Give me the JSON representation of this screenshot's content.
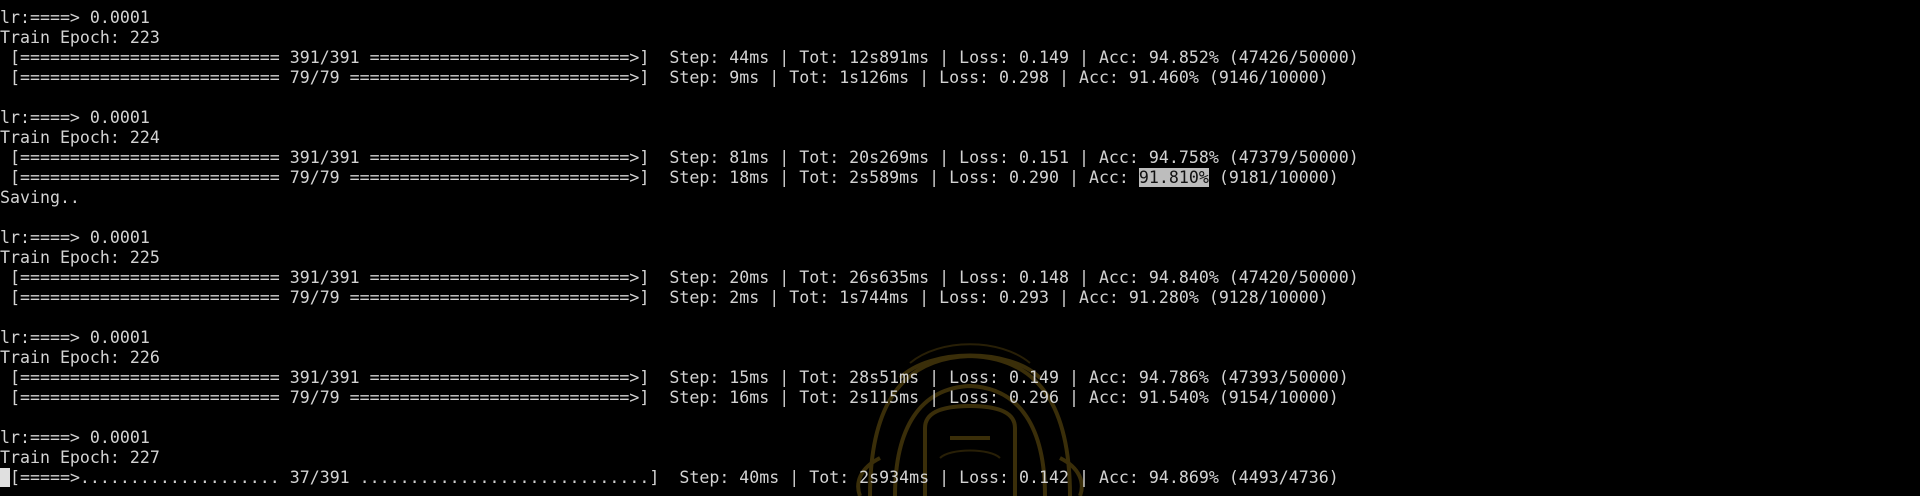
{
  "epochs": [
    {
      "lr_line": "lr:====> 0.0001",
      "epoch_line": "Train Epoch: 223",
      "train_bar": " [========================== 391/391 ==========================>]",
      "train_stats": "  Step: 44ms | Tot: 12s891ms | Loss: 0.149 | Acc: 94.852% (47426/50000)",
      "test_bar": " [========================== 79/79 ============================>]",
      "test_stats": "  Step: 9ms | Tot: 1s126ms | Loss: 0.298 | Acc: 91.460% (9146/10000)"
    },
    {
      "lr_line": "lr:====> 0.0001",
      "epoch_line": "Train Epoch: 224",
      "train_bar": " [========================== 391/391 ==========================>]",
      "train_stats": "  Step: 81ms | Tot: 20s269ms | Loss: 0.151 | Acc: 94.758% (47379/50000)",
      "test_bar": " [========================== 79/79 ============================>]",
      "test_stats_prefix": "  Step: 18ms | Tot: 2s589ms | Loss: 0.290 | Acc: ",
      "test_stats_highlight": "91.810%",
      "test_stats_suffix": " (9181/10000)",
      "saving_line": "Saving.."
    },
    {
      "lr_line": "lr:====> 0.0001",
      "epoch_line": "Train Epoch: 225",
      "train_bar": " [========================== 391/391 ==========================>]",
      "train_stats": "  Step: 20ms | Tot: 26s635ms | Loss: 0.148 | Acc: 94.840% (47420/50000)",
      "test_bar": " [========================== 79/79 ============================>]",
      "test_stats": "  Step: 2ms | Tot: 1s744ms | Loss: 0.293 | Acc: 91.280% (9128/10000)"
    },
    {
      "lr_line": "lr:====> 0.0001",
      "epoch_line": "Train Epoch: 226",
      "train_bar": " [========================== 391/391 ==========================>]",
      "train_stats": "  Step: 15ms | Tot: 28s51ms | Loss: 0.149 | Acc: 94.786% (47393/50000)",
      "test_bar": " [========================== 79/79 ============================>]",
      "test_stats": "  Step: 16ms | Tot: 2s115ms | Loss: 0.296 | Acc: 91.540% (9154/10000)"
    },
    {
      "lr_line": "lr:====> 0.0001",
      "epoch_line": "Train Epoch: 227",
      "cursor_char": " ",
      "progress_bar": "[=====>.................... 37/391 .............................]",
      "progress_stats": "  Step: 40ms | Tot: 2s934ms | Loss: 0.142 | Acc: 94.869% (4493/4736)"
    }
  ],
  "colors": {
    "background": "#000000",
    "text": "#d3d3d3",
    "selection": "#bdbdbd",
    "watermark": "#8a6d1a"
  },
  "icons": {
    "watermark": "wallpaper-emblem-icon"
  }
}
